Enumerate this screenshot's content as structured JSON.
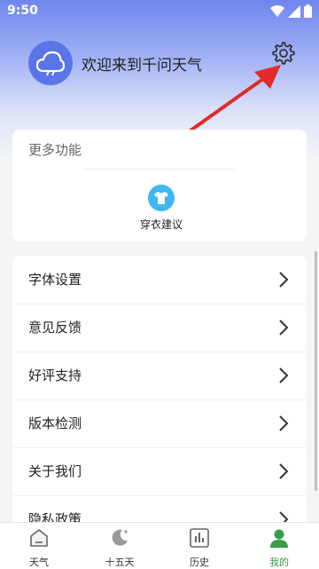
{
  "status_bar": {
    "time": "9:50"
  },
  "header": {
    "welcome_text": "欢迎来到千问天气"
  },
  "more_features": {
    "title": "更多功能",
    "items": [
      {
        "label": "穿衣建议",
        "icon": "tshirt-icon"
      }
    ]
  },
  "settings_list": [
    {
      "label": "字体设置"
    },
    {
      "label": "意见反馈"
    },
    {
      "label": "好评支持"
    },
    {
      "label": "版本检测"
    },
    {
      "label": "关于我们"
    },
    {
      "label": "隐私政策"
    }
  ],
  "bottom_nav": [
    {
      "label": "天气",
      "icon": "house-icon",
      "active": false
    },
    {
      "label": "十五天",
      "icon": "moon-icon",
      "active": false
    },
    {
      "label": "历史",
      "icon": "bar-chart-icon",
      "active": false
    },
    {
      "label": "我的",
      "icon": "user-icon",
      "active": true
    }
  ],
  "colors": {
    "accent": "#5a75e8",
    "active_tab": "#3a9b47",
    "annotation_arrow": "#e12b2b",
    "feature_icon": "#3fb6f2"
  }
}
